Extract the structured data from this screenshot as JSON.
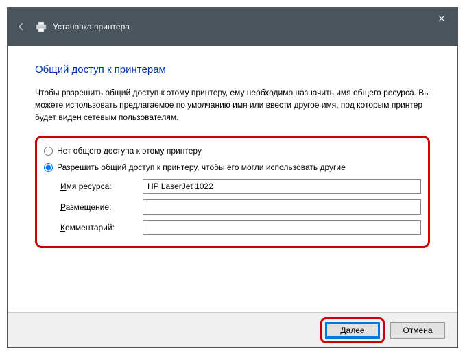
{
  "window": {
    "title": "Установка принтера"
  },
  "page": {
    "heading": "Общий доступ к принтерам",
    "description": "Чтобы разрешить общий доступ к этому принтеру, ему необходимо назначить имя общего ресурса. Вы можете использовать предлагаемое по умолчанию имя или ввести другое имя, под которым принтер будет виден сетевым пользователям."
  },
  "options": {
    "no_share_label": "Нет общего доступа к этому принтеру",
    "share_label": "Разрешить общий доступ к принтеру, чтобы его могли использовать другие"
  },
  "fields": {
    "resource_label_pre": "И",
    "resource_label_rest": "мя ресурса:",
    "resource_value": "HP LaserJet 1022",
    "location_label_pre": "Р",
    "location_label_rest": "азмещение:",
    "location_value": "",
    "comment_label_pre": "К",
    "comment_label_rest": "омментарий:",
    "comment_value": ""
  },
  "buttons": {
    "next_pre": "Д",
    "next_rest": "алее",
    "cancel": "Отмена"
  }
}
